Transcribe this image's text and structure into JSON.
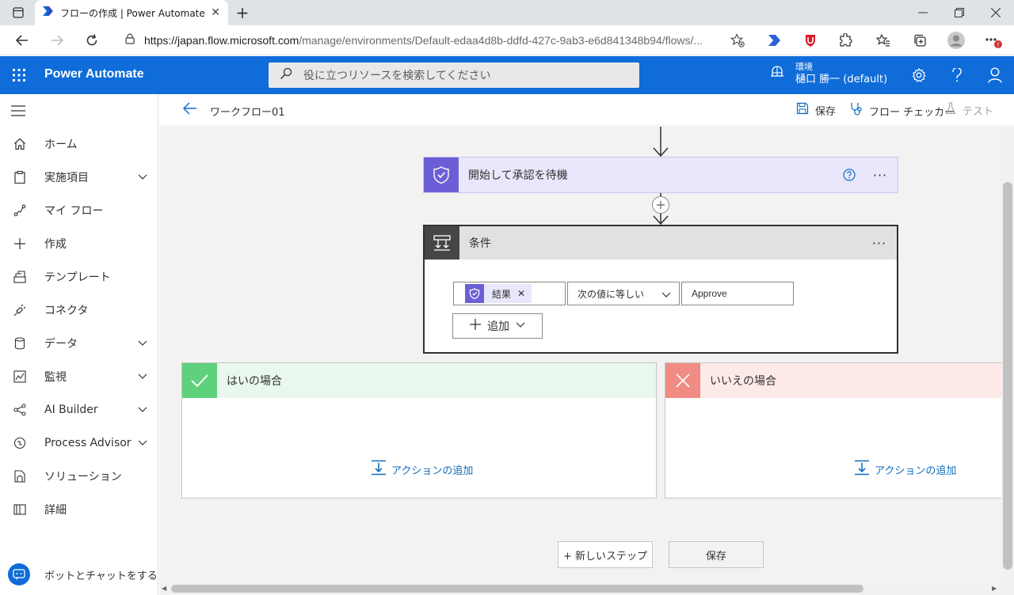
{
  "browser": {
    "tab_title": "フローの作成 | Power Automate",
    "url_host": "https://japan.flow.microsoft.com",
    "url_path": "/manage/environments/Default-edaa4d8b-ddfd-427c-9ab3-e6d841348b94/flows/..."
  },
  "header": {
    "app_name": "Power Automate",
    "search_placeholder": "役に立つリソースを検索してください",
    "env_label": "環境",
    "env_name": "樋口 勝一 (default)"
  },
  "nav": {
    "items": [
      {
        "label": "ホーム"
      },
      {
        "label": "実施項目"
      },
      {
        "label": "マイ フロー"
      },
      {
        "label": "作成"
      },
      {
        "label": "テンプレート"
      },
      {
        "label": "コネクタ"
      },
      {
        "label": "データ"
      },
      {
        "label": "監視"
      },
      {
        "label": "AI Builder"
      },
      {
        "label": "Process Advisor"
      },
      {
        "label": "ソリューション"
      },
      {
        "label": "詳細"
      }
    ],
    "bot_label": "ボットとチャットをする"
  },
  "commandbar": {
    "flow_name": "ワークフロー01",
    "save": "保存",
    "checker": "フロー チェッカー",
    "test": "テスト"
  },
  "canvas": {
    "approval_title": "開始して承認を待機",
    "condition_title": "条件",
    "condition_token": "結果",
    "condition_operator": "次の値に等しい",
    "condition_value": "Approve",
    "add_label": "追加",
    "yes_title": "はいの場合",
    "no_title": "いいえの場合",
    "add_action": "アクションの追加",
    "new_step": "+ 新しいステップ",
    "save": "保存"
  },
  "colors": {
    "brand": "#0f6cd9",
    "approval": "#6c5fd6",
    "yes": "#5fd07c",
    "no": "#f08c84",
    "condition": "#484644"
  }
}
